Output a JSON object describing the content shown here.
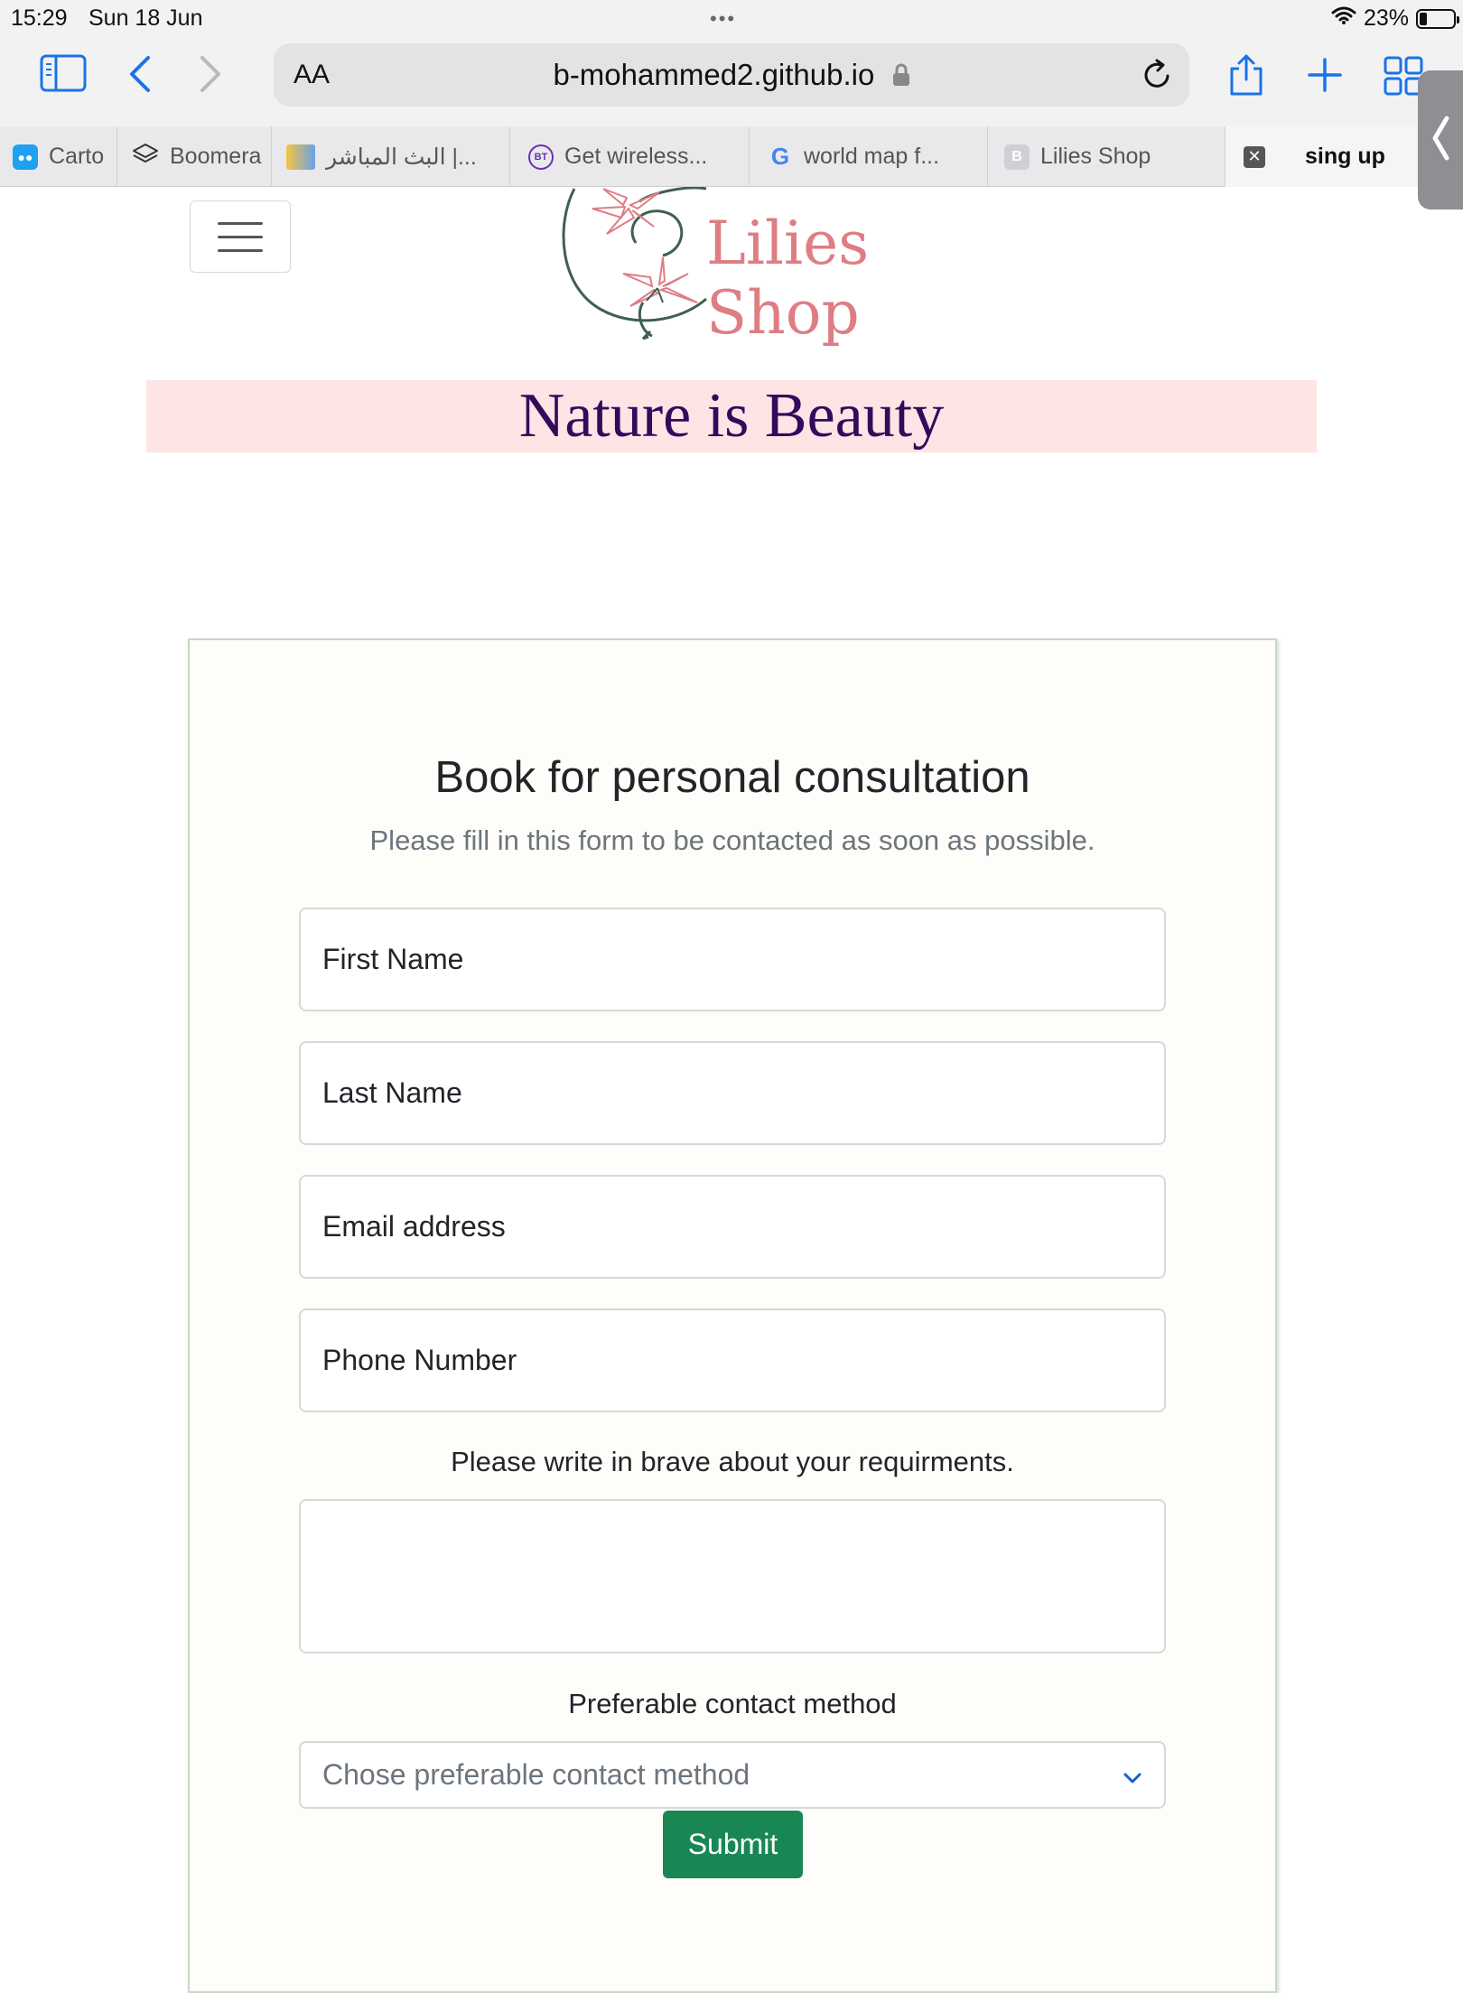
{
  "status": {
    "time": "15:29",
    "date": "Sun 18 Jun",
    "battery_percent": "23%",
    "battery_level": 0.23
  },
  "browser": {
    "text_size_label": "AA",
    "url": "b-mohammed2.github.io",
    "icons": [
      "sidebar-icon",
      "back-icon",
      "forward-icon",
      "lock-icon",
      "reload-icon",
      "share-icon",
      "new-tab-icon",
      "tab-overview-icon"
    ]
  },
  "tabs": [
    {
      "label": "Carto",
      "favicon": "owl-eyes"
    },
    {
      "label": "Boomera",
      "favicon": "stack"
    },
    {
      "label": "البث المباشر |...",
      "favicon": "flag"
    },
    {
      "label": "Get wireless...",
      "favicon": "BT"
    },
    {
      "label": "world map f...",
      "favicon": "G"
    },
    {
      "label": "Lilies Shop",
      "favicon": "B"
    },
    {
      "label": "sing up",
      "favicon": "close"
    }
  ],
  "page": {
    "logo_text": "Lilies Shop",
    "banner": "Nature is Beauty",
    "accent_color": "#df7d84",
    "banner_color": "#330a5c",
    "form": {
      "title": "Book for personal consultation",
      "subtitle": "Please fill in this form to be contacted as soon as possible.",
      "first_name": "First Name",
      "last_name": "Last Name",
      "email": "Email address",
      "phone": "Phone Number",
      "requirements_label": "Please write in brave about your requirments.",
      "requirements_value": "",
      "contact_label": "Preferable contact method",
      "contact_placeholder": "Chose preferable contact method",
      "submit": "Submit",
      "submit_color": "#198754"
    }
  }
}
